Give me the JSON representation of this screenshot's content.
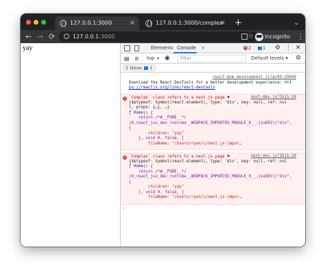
{
  "tabs": [
    {
      "title": "127.0.0.1:3000",
      "close": "×",
      "active": true
    },
    {
      "title": "127.0.0.1:3000/complex",
      "close": "×",
      "active": false
    }
  ],
  "new_tab": "+",
  "collapse_tabs": "⌄",
  "toolbar": {
    "back": "←",
    "forward": "→",
    "reload": "⟳",
    "url_host": "127.0.0.1",
    "url_port": ":3000",
    "bookmark": "☆",
    "profile": "Incognito",
    "menu": "⋮"
  },
  "page": {
    "text": "yay"
  },
  "devtools": {
    "tabs": [
      "Elements",
      "Console",
      "»"
    ],
    "active_tab": "Console",
    "error_count": "2",
    "info_count": "1",
    "top": "top",
    "filter_placeholder": "Filter",
    "levels": "Default levels ▾",
    "issues_label": "1 Issue:",
    "issues_count": "1",
    "messages": {
      "devtools_source": "react-dom.development.js?ac89:29840",
      "devtools_line1": "Download the React DevTools for a better development experience: htt",
      "devtools_line2": "ps://reactjs.org/link/react-devtools",
      "error_title": "`Complex` class refers to a next.js page",
      "error_source": "next-dev.js?3515:20",
      "err_lines": [
        "{$$typeof: Symbol(react.element), type: 'div', key: null, ref: nul",
        "l, props: {…}, …}",
        "ƒ Home() {",
        "    return /*#__PURE__*/",
        "(0,react_jsx_dev_runtime__WEBPACK_IMPORTED_MODULE_0__.jsxDEV)(\"div\",",
        "{",
        "        children: \"yay\"",
        "    }, void 0, false, {",
        "        fileName: \"/Users/ryan/c/next.js-impor…"
      ]
    },
    "prompt": "›"
  },
  "colors": {
    "tab_bar": "#202124",
    "toolbar": "#35363a",
    "error_bg": "#fff0f0",
    "accent": "#1a73e8"
  }
}
